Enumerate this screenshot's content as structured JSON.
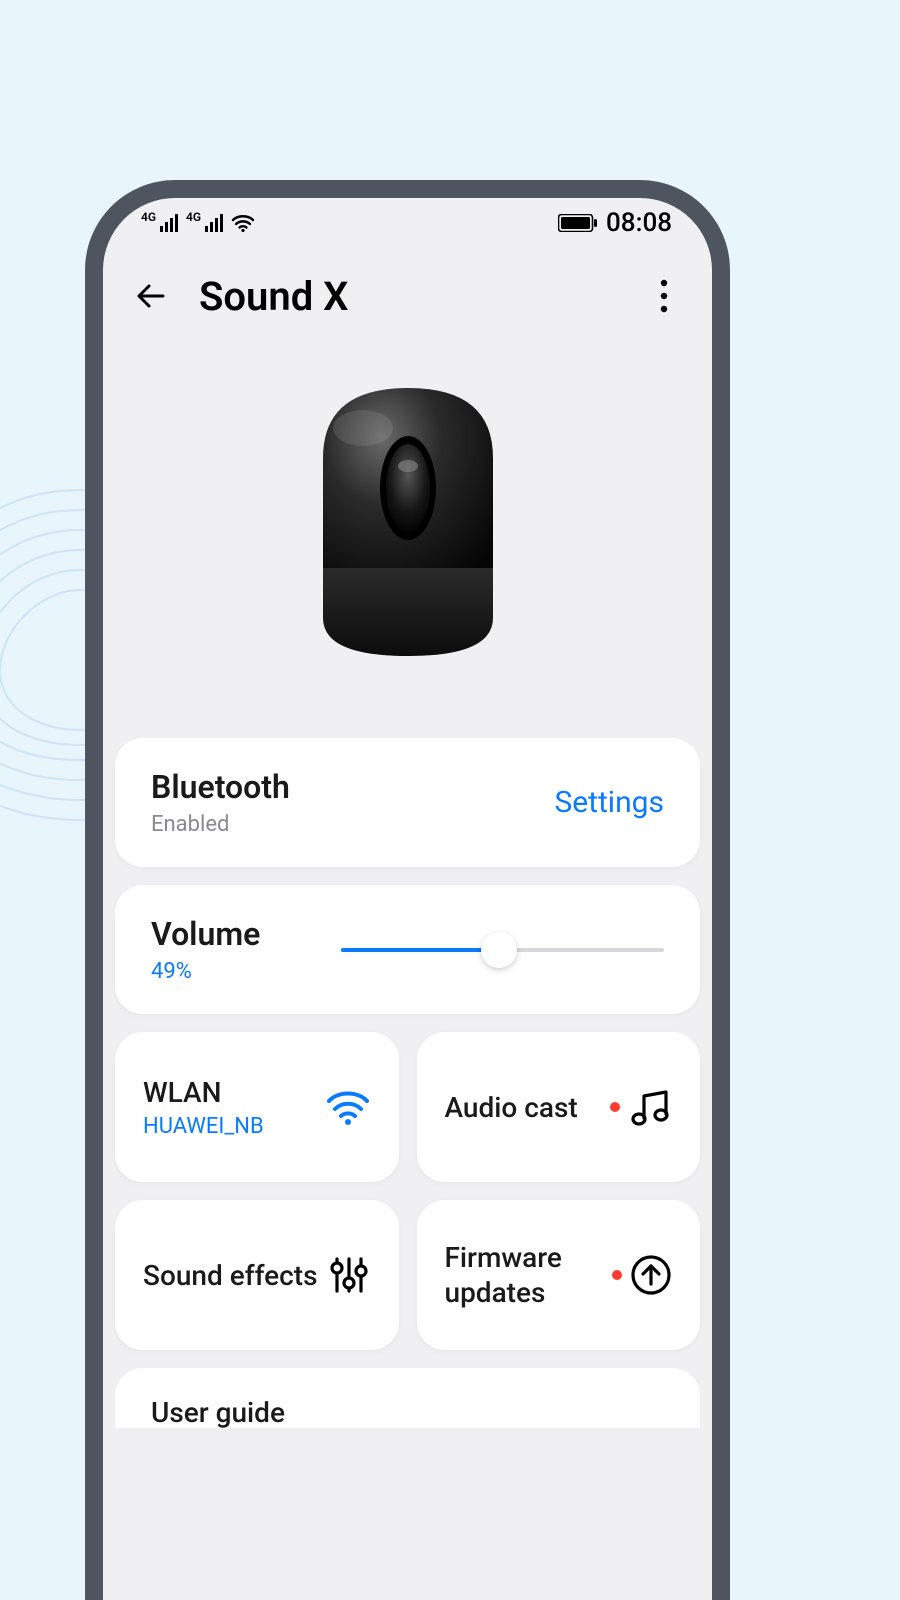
{
  "statusbar": {
    "signal1": "4G",
    "signal2": "4G",
    "wifi": "4G",
    "time": "08:08"
  },
  "header": {
    "title": "Sound X"
  },
  "cards": {
    "bluetooth": {
      "title": "Bluetooth",
      "status": "Enabled",
      "action": "Settings"
    },
    "volume": {
      "title": "Volume",
      "value_text": "49%",
      "value_pct": 49
    }
  },
  "tiles": {
    "wlan": {
      "title": "WLAN",
      "ssid": "HUAWEI_NB"
    },
    "audio": {
      "title": "Audio cast"
    },
    "effects": {
      "title": "Sound effects"
    },
    "firmware": {
      "title": "Firmware updates"
    }
  },
  "partial": {
    "title": "User guide"
  },
  "colors": {
    "accent": "#0a7aff",
    "danger": "#ff3b30"
  }
}
